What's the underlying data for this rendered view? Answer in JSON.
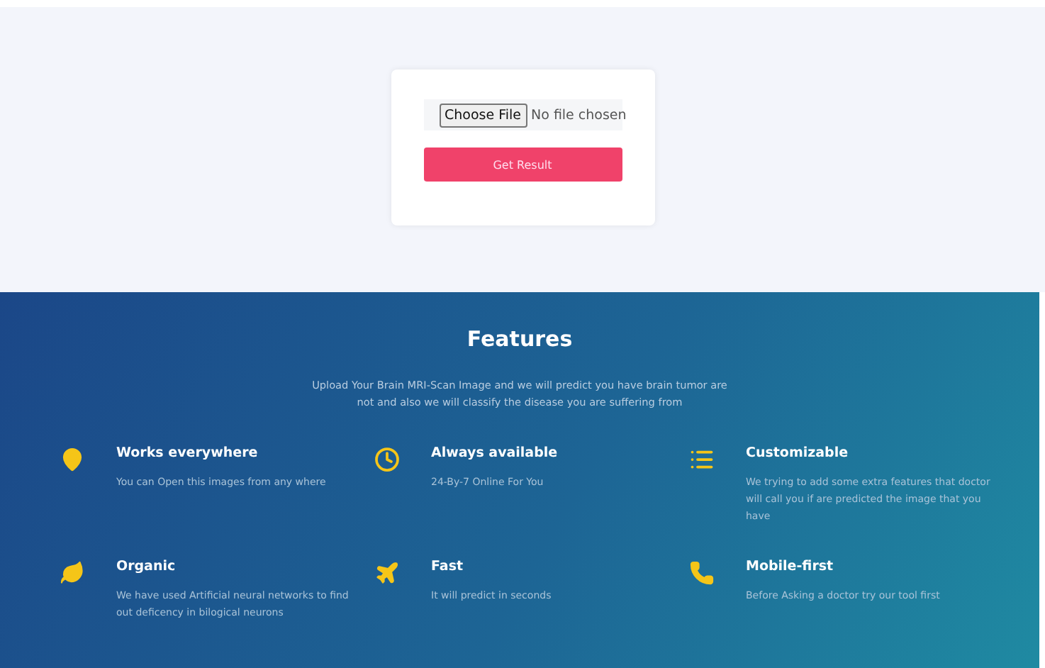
{
  "upload": {
    "choose_button": "Choose File",
    "file_status": "No file chosen",
    "submit_button": "Get Result"
  },
  "features": {
    "title": "Features",
    "description": "Upload Your Brain MRI-Scan Image and we will predict you have brain tumor are not and also we will classify the disease you are suffering from",
    "items": [
      {
        "title": "Works everywhere",
        "text": "You can Open this images from any where"
      },
      {
        "title": "Always available",
        "text": "24-By-7 Online For You"
      },
      {
        "title": "Customizable",
        "text": "We trying to add some extra features that doctor will call you if are predicted the image that you have"
      },
      {
        "title": "Organic",
        "text": "We have used Artificial neural networks to find out deficency in bilogical neurons"
      },
      {
        "title": "Fast",
        "text": "It will predict in seconds"
      },
      {
        "title": "Mobile-first",
        "text": "Before Asking a doctor try our tool first"
      }
    ]
  }
}
